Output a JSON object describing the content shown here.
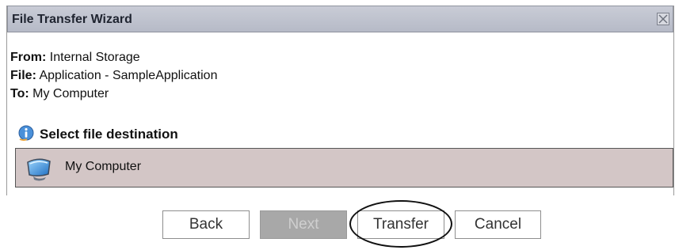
{
  "window": {
    "title": "File Transfer Wizard",
    "close_icon": "close-icon"
  },
  "transfer_info": {
    "from_label": "From:",
    "from_value": "Internal Storage",
    "file_label": "File:",
    "file_value": "Application - SampleApplication",
    "to_label": "To:",
    "to_value": "My Computer"
  },
  "destination_section": {
    "icon": "info-icon",
    "heading": "Select file destination",
    "items": [
      {
        "label": "My Computer",
        "icon": "computer-monitor-icon",
        "selected": true
      }
    ]
  },
  "buttons": {
    "back_label": "Back",
    "next_label": "Next",
    "next_disabled": true,
    "transfer_label": "Transfer",
    "cancel_label": "Cancel"
  },
  "colors": {
    "title_bar": "#c1c4cf",
    "selected_row": "#d3c6c6",
    "disabled_button": "#a8a8a8"
  }
}
